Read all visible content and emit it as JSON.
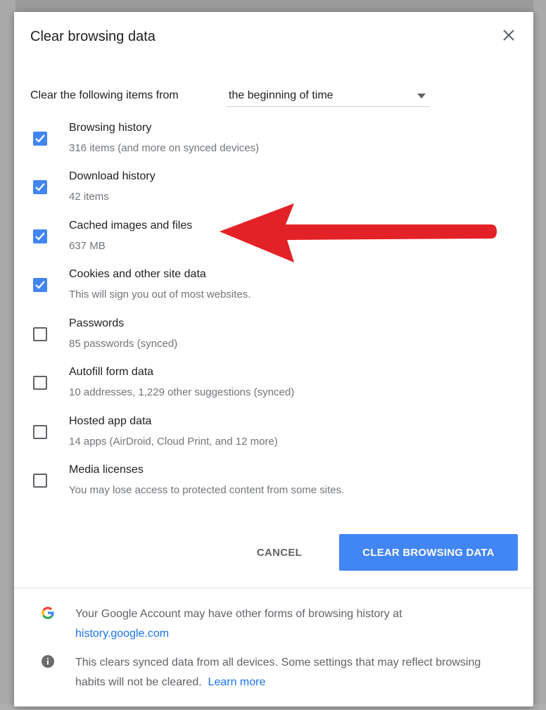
{
  "dialog": {
    "title": "Clear browsing data",
    "close_icon": "close-icon"
  },
  "time_range": {
    "label": "Clear the following items from",
    "selected": "the beginning of time"
  },
  "items": [
    {
      "title": "Browsing history",
      "subtitle": "316 items (and more on synced devices)",
      "checked": true
    },
    {
      "title": "Download history",
      "subtitle": "42 items",
      "checked": true
    },
    {
      "title": "Cached images and files",
      "subtitle": "637 MB",
      "checked": true
    },
    {
      "title": "Cookies and other site data",
      "subtitle": "This will sign you out of most websites.",
      "checked": true
    },
    {
      "title": "Passwords",
      "subtitle": "85 passwords (synced)",
      "checked": false
    },
    {
      "title": "Autofill form data",
      "subtitle": "10 addresses, 1,229 other suggestions (synced)",
      "checked": false
    },
    {
      "title": "Hosted app data",
      "subtitle": "14 apps (AirDroid, Cloud Print, and 12 more)",
      "checked": false
    },
    {
      "title": "Media licenses",
      "subtitle": "You may lose access to protected content from some sites.",
      "checked": false
    }
  ],
  "actions": {
    "cancel_label": "CANCEL",
    "clear_label": "CLEAR BROWSING DATA"
  },
  "footer": {
    "google_text": "Your Google Account may have other forms of browsing history at",
    "google_link": "history.google.com",
    "info_text": "This clears synced data from all devices. Some settings that may reflect browsing habits will not be cleared.",
    "learn_more": "Learn more"
  },
  "colors": {
    "accent": "#4285f4",
    "annotation_arrow": "#e32227"
  }
}
